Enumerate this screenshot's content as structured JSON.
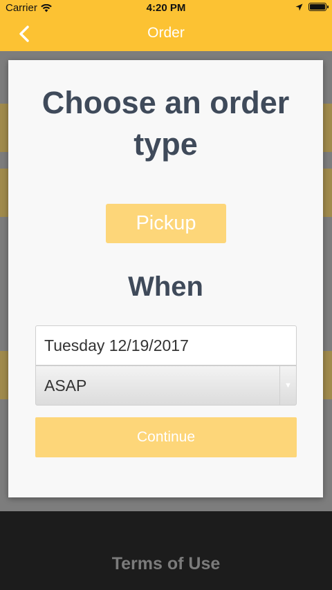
{
  "status_bar": {
    "carrier": "Carrier",
    "time": "4:20 PM",
    "icons": [
      "wifi-icon",
      "location-arrow-icon",
      "battery-icon"
    ]
  },
  "nav": {
    "title": "Order",
    "back_icon": "chevron-left-icon"
  },
  "modal": {
    "heading": "Choose an order type",
    "pickup_label": "Pickup",
    "when_label": "When",
    "date_value": "Tuesday 12/19/2017",
    "time_selected": "ASAP",
    "continue_label": "Continue"
  },
  "footer": {
    "terms_label": "Terms of Use"
  },
  "colors": {
    "accent": "#fcc233",
    "button_fill": "#fdd679",
    "heading_text": "#3f4a5a"
  }
}
